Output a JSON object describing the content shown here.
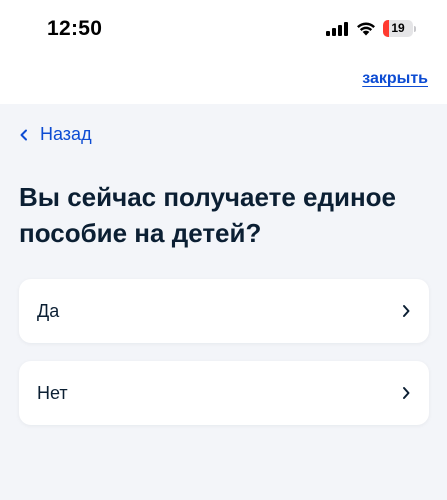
{
  "status_bar": {
    "time": "12:50",
    "battery_level": "19",
    "battery_fraction": 0.19,
    "icons": [
      "signal-icon",
      "wifi-icon",
      "battery-icon"
    ]
  },
  "header": {
    "close_label": "закрыть"
  },
  "navigation": {
    "back_label": "Назад",
    "back_icon": "chevron-left-icon"
  },
  "question": {
    "title": "Вы сейчас получаете единое пособие на детей?"
  },
  "options": [
    {
      "label": "Да",
      "icon": "chevron-right-icon"
    },
    {
      "label": "Нет",
      "icon": "chevron-right-icon"
    }
  ],
  "colors": {
    "accent": "#0d4cd3",
    "text": "#0b1f33",
    "background": "#f3f5f9",
    "card": "#ffffff",
    "battery_low": "#ff3b30"
  }
}
